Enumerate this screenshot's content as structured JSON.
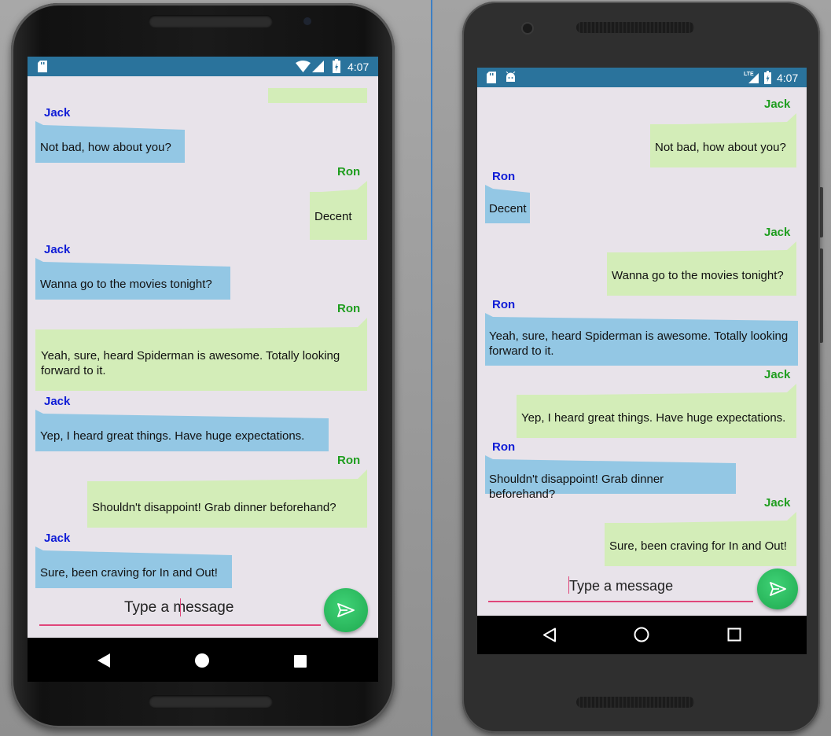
{
  "left_device": {
    "status_bar": {
      "time": "4:07"
    },
    "messages": [
      {
        "sender": "",
        "text": "",
        "side": "right"
      },
      {
        "sender": "Jack",
        "text": "Not bad, how about you?",
        "side": "left"
      },
      {
        "sender": "Ron",
        "text": "Decent",
        "side": "right"
      },
      {
        "sender": "Jack",
        "text": "Wanna go to the movies tonight?",
        "side": "left"
      },
      {
        "sender": "Ron",
        "text": "Yeah, sure, heard Spiderman is awesome. Totally looking forward to it.",
        "side": "right"
      },
      {
        "sender": "Jack",
        "text": "Yep, I heard great things. Have huge expectations.",
        "side": "left"
      },
      {
        "sender": "Ron",
        "text": "Shouldn't disappoint! Grab dinner beforehand?",
        "side": "right"
      },
      {
        "sender": "Jack",
        "text": "Sure, been craving for In and Out!",
        "side": "left"
      }
    ],
    "input": {
      "placeholder": "Type a message"
    }
  },
  "right_device": {
    "status_bar": {
      "time": "4:07",
      "network": "LTE"
    },
    "messages": [
      {
        "sender": "Jack",
        "text": "Not bad, how about you?",
        "side": "right"
      },
      {
        "sender": "Ron",
        "text": "Decent",
        "side": "left"
      },
      {
        "sender": "Jack",
        "text": "Wanna go to the movies tonight?",
        "side": "right"
      },
      {
        "sender": "Ron",
        "text": "Yeah, sure, heard Spiderman is awesome. Totally looking forward to it.",
        "side": "left"
      },
      {
        "sender": "Jack",
        "text": "Yep, I heard great things. Have huge expectations.",
        "side": "right"
      },
      {
        "sender": "Ron",
        "text": "Shouldn't disappoint! Grab dinner beforehand?",
        "side": "left"
      },
      {
        "sender": "Jack",
        "text": "Sure, been craving for In and Out!",
        "side": "right"
      }
    ],
    "input": {
      "placeholder": "Type a message"
    }
  },
  "colors": {
    "incoming_bubble": "#93c7e4",
    "outgoing_bubble": "#d3edb8",
    "incoming_name": "#0f1cd6",
    "outgoing_name": "#1e9d1e",
    "status_bar": "#2a739c",
    "chat_background": "#e8e3ea",
    "send_button": "#2dbd62",
    "input_underline": "#e0467a"
  },
  "icons": {
    "send": "send-arrow-icon",
    "back": "back-triangle-icon",
    "home": "home-circle-icon",
    "recents": "recents-square-icon",
    "sd_card": "sd-card-icon",
    "android": "android-debug-icon",
    "wifi": "wifi-icon",
    "signal": "signal-icon",
    "battery": "battery-charging-icon"
  }
}
